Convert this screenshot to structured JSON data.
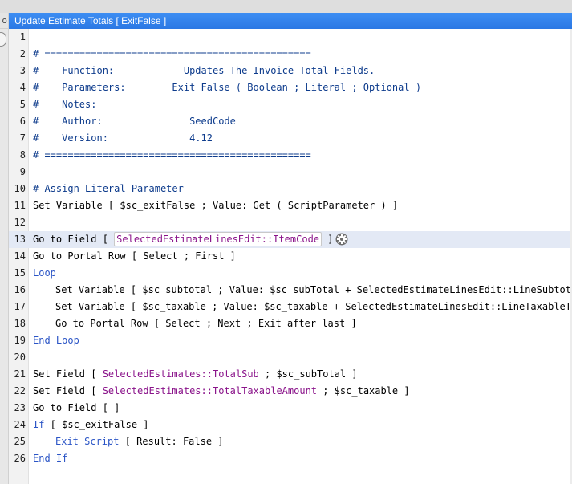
{
  "side_tab_label": "o",
  "tab": {
    "title": "Update Estimate Totals [ ExitFalse ]"
  },
  "colors": {
    "tab": "#2b78e4",
    "comment": "#0d3b8c",
    "keyword": "#2b55c6",
    "field": "#8a138a",
    "current_line": "#e3e9f5"
  },
  "lines": [
    {
      "n": "1",
      "indent": false,
      "current": false,
      "segments": []
    },
    {
      "n": "2",
      "indent": false,
      "current": false,
      "segments": [
        {
          "t": "c",
          "text": "# =============================================="
        }
      ]
    },
    {
      "n": "3",
      "indent": false,
      "current": false,
      "segments": [
        {
          "t": "c",
          "text": "#    Function:            Updates The Invoice Total Fields."
        }
      ]
    },
    {
      "n": "4",
      "indent": false,
      "current": false,
      "segments": [
        {
          "t": "c",
          "text": "#    Parameters:        Exit False ( Boolean ; Literal ; Optional )"
        }
      ]
    },
    {
      "n": "5",
      "indent": false,
      "current": false,
      "segments": [
        {
          "t": "c",
          "text": "#    Notes:"
        }
      ]
    },
    {
      "n": "6",
      "indent": false,
      "current": false,
      "segments": [
        {
          "t": "c",
          "text": "#    Author:               SeedCode"
        }
      ]
    },
    {
      "n": "7",
      "indent": false,
      "current": false,
      "segments": [
        {
          "t": "c",
          "text": "#    Version:              4.12"
        }
      ]
    },
    {
      "n": "8",
      "indent": false,
      "current": false,
      "segments": [
        {
          "t": "c",
          "text": "# =============================================="
        }
      ]
    },
    {
      "n": "9",
      "indent": false,
      "current": false,
      "segments": []
    },
    {
      "n": "10",
      "indent": false,
      "current": false,
      "segments": [
        {
          "t": "c",
          "text": "# Assign Literal Parameter"
        }
      ]
    },
    {
      "n": "11",
      "indent": false,
      "current": false,
      "segments": [
        {
          "t": "p",
          "text": "Set Variable [ $sc_exitFalse ; Value: Get ( ScriptParameter ) ]"
        }
      ]
    },
    {
      "n": "12",
      "indent": false,
      "current": false,
      "segments": []
    },
    {
      "n": "13",
      "indent": false,
      "current": true,
      "segments": [
        {
          "t": "p",
          "text": "Go to Field [ "
        },
        {
          "t": "fb",
          "text": "SelectedEstimateLinesEdit::ItemCode"
        },
        {
          "t": "p",
          "text": " ]"
        },
        {
          "t": "gear"
        }
      ]
    },
    {
      "n": "14",
      "indent": false,
      "current": false,
      "segments": [
        {
          "t": "p",
          "text": "Go to Portal Row [ Select ; First ]"
        }
      ]
    },
    {
      "n": "15",
      "indent": false,
      "current": false,
      "segments": [
        {
          "t": "k",
          "text": "Loop"
        }
      ]
    },
    {
      "n": "16",
      "indent": true,
      "current": false,
      "segments": [
        {
          "t": "p",
          "text": "Set Variable [ $sc_subtotal ; Value: $sc_subTotal + SelectedEstimateLinesEdit::LineSubtotal ]"
        }
      ]
    },
    {
      "n": "17",
      "indent": true,
      "current": false,
      "segments": [
        {
          "t": "p",
          "text": "Set Variable [ $sc_taxable ; Value: $sc_taxable + SelectedEstimateLinesEdit::LineTaxableTotal ]"
        }
      ]
    },
    {
      "n": "18",
      "indent": true,
      "current": false,
      "segments": [
        {
          "t": "p",
          "text": "Go to Portal Row [ Select ; Next ; Exit after last ]"
        }
      ]
    },
    {
      "n": "19",
      "indent": false,
      "current": false,
      "segments": [
        {
          "t": "k",
          "text": "End Loop"
        }
      ]
    },
    {
      "n": "20",
      "indent": false,
      "current": false,
      "segments": []
    },
    {
      "n": "21",
      "indent": false,
      "current": false,
      "segments": [
        {
          "t": "p",
          "text": "Set Field [ "
        },
        {
          "t": "f",
          "text": "SelectedEstimates::TotalSub"
        },
        {
          "t": "p",
          "text": " ; $sc_subTotal ]"
        }
      ]
    },
    {
      "n": "22",
      "indent": false,
      "current": false,
      "segments": [
        {
          "t": "p",
          "text": "Set Field [ "
        },
        {
          "t": "f",
          "text": "SelectedEstimates::TotalTaxableAmount"
        },
        {
          "t": "p",
          "text": " ; $sc_taxable ]"
        }
      ]
    },
    {
      "n": "23",
      "indent": false,
      "current": false,
      "segments": [
        {
          "t": "p",
          "text": "Go to Field [ ]"
        }
      ]
    },
    {
      "n": "24",
      "indent": false,
      "current": false,
      "segments": [
        {
          "t": "k",
          "text": "If"
        },
        {
          "t": "p",
          "text": " [ $sc_exitFalse ]"
        }
      ]
    },
    {
      "n": "25",
      "indent": true,
      "current": false,
      "segments": [
        {
          "t": "k",
          "text": "Exit Script"
        },
        {
          "t": "p",
          "text": " [ Result: False ]"
        }
      ]
    },
    {
      "n": "26",
      "indent": false,
      "current": false,
      "segments": [
        {
          "t": "k",
          "text": "End If"
        }
      ]
    }
  ]
}
